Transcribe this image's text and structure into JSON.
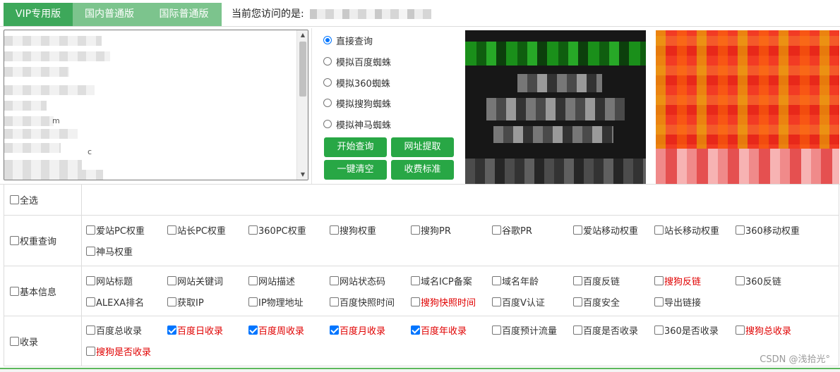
{
  "tabs": {
    "vip": "VIP专用版",
    "domestic": "国内普通版",
    "international": "国际普通版"
  },
  "visit": {
    "label": "当前您访问的是:"
  },
  "textarea": {
    "visible_fragments": [
      "m",
      "c"
    ]
  },
  "query_modes": [
    {
      "label": "直接查询",
      "selected": true
    },
    {
      "label": "模拟百度蜘蛛",
      "selected": false
    },
    {
      "label": "模拟360蜘蛛",
      "selected": false
    },
    {
      "label": "模拟搜狗蜘蛛",
      "selected": false
    },
    {
      "label": "模拟神马蜘蛛",
      "selected": false
    }
  ],
  "buttons": {
    "start": "开始查询",
    "extract": "网址提取",
    "clear": "一键清空",
    "pricing": "收费标准"
  },
  "options": {
    "select_all": "全选",
    "weight": {
      "label": "权重查询",
      "items": [
        {
          "label": "爱站PC权重",
          "checked": false,
          "red": false
        },
        {
          "label": "站长PC权重",
          "checked": false,
          "red": false
        },
        {
          "label": "360PC权重",
          "checked": false,
          "red": false
        },
        {
          "label": "搜狗权重",
          "checked": false,
          "red": false
        },
        {
          "label": "搜狗PR",
          "checked": false,
          "red": false
        },
        {
          "label": "谷歌PR",
          "checked": false,
          "red": false
        },
        {
          "label": "爱站移动权重",
          "checked": false,
          "red": false
        },
        {
          "label": "站长移动权重",
          "checked": false,
          "red": false
        },
        {
          "label": "360移动权重",
          "checked": false,
          "red": false
        },
        {
          "label": "神马权重",
          "checked": false,
          "red": false
        }
      ]
    },
    "basic": {
      "label": "基本信息",
      "items": [
        {
          "label": "网站标题",
          "checked": false,
          "red": false
        },
        {
          "label": "网站关键词",
          "checked": false,
          "red": false
        },
        {
          "label": "网站描述",
          "checked": false,
          "red": false
        },
        {
          "label": "网站状态码",
          "checked": false,
          "red": false
        },
        {
          "label": "域名ICP备案",
          "checked": false,
          "red": false
        },
        {
          "label": "域名年龄",
          "checked": false,
          "red": false
        },
        {
          "label": "百度反链",
          "checked": false,
          "red": false
        },
        {
          "label": "搜狗反链",
          "checked": false,
          "red": true
        },
        {
          "label": "360反链",
          "checked": false,
          "red": false
        },
        {
          "label": "ALEXA排名",
          "checked": false,
          "red": false
        },
        {
          "label": "获取IP",
          "checked": false,
          "red": false
        },
        {
          "label": "IP物理地址",
          "checked": false,
          "red": false
        },
        {
          "label": "百度快照时间",
          "checked": false,
          "red": false
        },
        {
          "label": "搜狗快照时间",
          "checked": false,
          "red": true
        },
        {
          "label": "百度V认证",
          "checked": false,
          "red": false
        },
        {
          "label": "百度安全",
          "checked": false,
          "red": false
        },
        {
          "label": "导出链接",
          "checked": false,
          "red": false
        }
      ]
    },
    "index": {
      "label": "收录",
      "items": [
        {
          "label": "百度总收录",
          "checked": false,
          "red": false
        },
        {
          "label": "百度日收录",
          "checked": true,
          "red": true
        },
        {
          "label": "百度周收录",
          "checked": true,
          "red": true
        },
        {
          "label": "百度月收录",
          "checked": true,
          "red": true
        },
        {
          "label": "百度年收录",
          "checked": true,
          "red": true
        },
        {
          "label": "百度预计流量",
          "checked": false,
          "red": false
        },
        {
          "label": "百度是否收录",
          "checked": false,
          "red": false
        },
        {
          "label": "360是否收录",
          "checked": false,
          "red": false
        },
        {
          "label": "搜狗总收录",
          "checked": false,
          "red": true
        },
        {
          "label": "搜狗是否收录",
          "checked": false,
          "red": true
        }
      ]
    }
  },
  "watermark": "CSDN @浅拾光°",
  "colors": {
    "tab_active": "#3da85a",
    "tab_inactive": "#7cc48d",
    "button": "#28a745",
    "highlight_text": "#e00000",
    "checkbox_on": "#0075ff"
  }
}
